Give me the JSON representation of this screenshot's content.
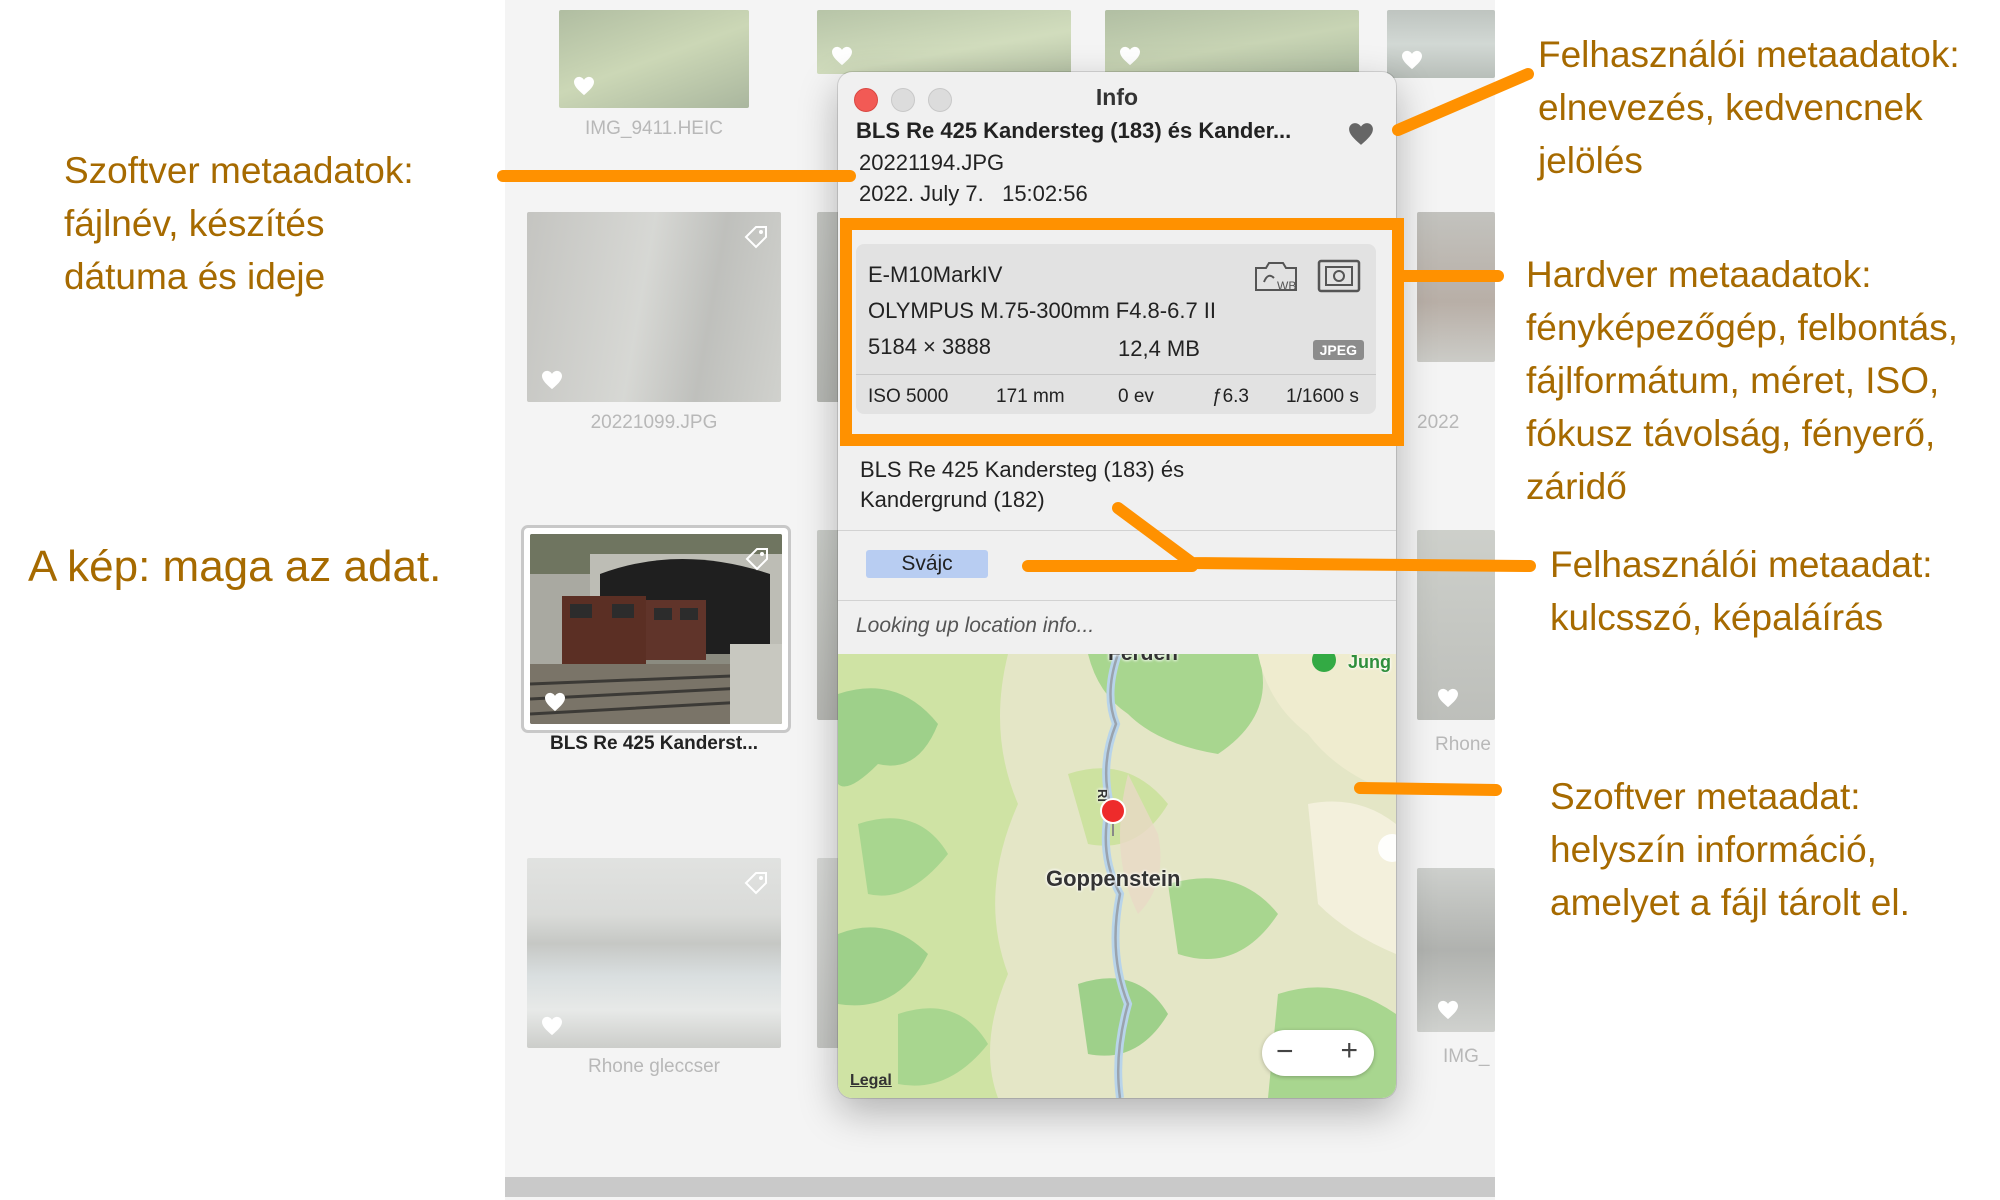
{
  "grid": {
    "labels": {
      "img9411": "IMG_9411.HEIC",
      "p20221099": "20221099.JPG",
      "selected": "BLS Re 425 Kanderst...",
      "rhone": "Rhone gleccser",
      "partial_2022": "2022",
      "partial_rhone": "Rhone",
      "partial_img": "IMG_"
    }
  },
  "info_window": {
    "title": "Info",
    "photo_title": "BLS Re 425 Kandersteg (183) és Kander...",
    "filename": "20221194.JPG",
    "date": "2022. July 7.   15:02:56",
    "hardware": {
      "camera": "E-M10MarkIV",
      "lens": "OLYMPUS M.75-300mm F4.8-6.7 II",
      "resolution": "5184 × 3888",
      "file_size": "12,4 MB",
      "format": "JPEG",
      "iso": "ISO 5000",
      "focal_length": "171 mm",
      "exposure_comp": "0 ev",
      "aperture": "ƒ6.3",
      "shutter": "1/1600 s",
      "icons": [
        "white-balance-icon",
        "metering-mode-icon"
      ]
    },
    "caption": "BLS Re 425 Kandersteg (183) és Kandergrund (182)",
    "keyword": "Svájc",
    "location_status": "Looking up location info...",
    "map": {
      "labels": [
        "Ferden",
        "Jung",
        "Rl",
        "Goppenstein"
      ],
      "zoom_out": "−",
      "zoom_in": "+",
      "legal": "Legal"
    }
  },
  "annotations": {
    "user_meta_top": [
      "Felhasználói metaadatok:",
      "elnevezés, kedvencnek",
      "jelölés"
    ],
    "software_meta_left": [
      "Szoftver metaadatok:",
      "fájlnév, készítés",
      "dátuma és ideje"
    ],
    "image_is_data": "A kép: maga az adat.",
    "hardware_meta": [
      "Hardver metaadatok:",
      "fényképezőgép, felbontás,",
      "fájlformátum, méret, ISO,",
      "fókusz távolság, fényerő,",
      "záridő"
    ],
    "user_meta_keyword": [
      "Felhasználói metaadat:",
      "kulcsszó, képaláírás"
    ],
    "software_meta_location": [
      "Szoftver metaadat:",
      "helyszín információ,",
      "amelyet a fájl tárolt el."
    ]
  },
  "colors": {
    "annotation_text": "#a66a00",
    "annotation_line": "#ff9100",
    "keyword_chip": "#b8cdf2",
    "close_button": "#f25a55"
  }
}
